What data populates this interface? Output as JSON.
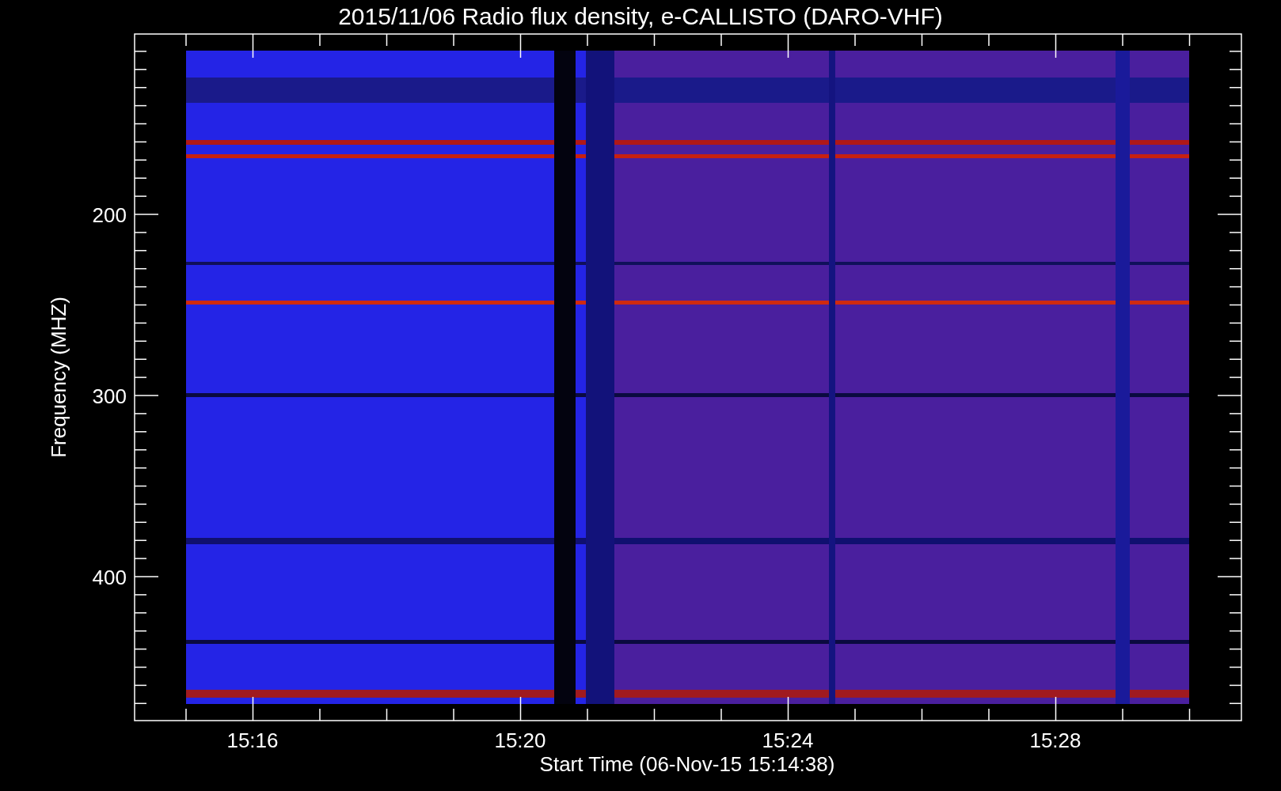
{
  "title": "2015/11/06  Radio flux density, e-CALLISTO (DARO-VHF)",
  "y_axis": {
    "title": "Frequency (MHZ)",
    "tick_labels": [
      "200",
      "300",
      "400"
    ]
  },
  "x_axis": {
    "title": "Start Time (06-Nov-15 15:14:38)",
    "tick_labels": [
      "15:16",
      "15:20",
      "15:24",
      "15:28"
    ]
  }
}
